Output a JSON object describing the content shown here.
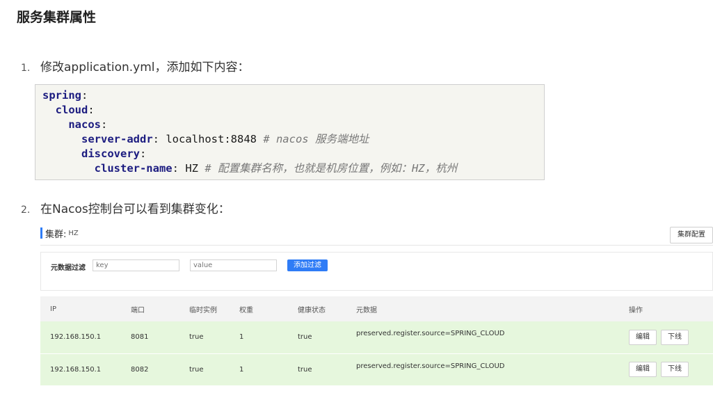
{
  "heading": "服务集群属性",
  "steps": [
    {
      "num": "1.",
      "text": "修改application.yml，添加如下内容："
    },
    {
      "num": "2.",
      "text": "在Nacos控制台可以看到集群变化："
    }
  ],
  "code": {
    "l1_key": "spring",
    "l2_key": "cloud",
    "l3_key": "nacos",
    "l4_key": "server-addr",
    "l4_val": " localhost:8848 ",
    "l4_comment": "# nacos 服务端地址",
    "l5_key": "discovery",
    "l6_key": "cluster-name",
    "l6_val": " HZ ",
    "l6_comment": "# 配置集群名称，也就是机房位置，例如：HZ，杭州"
  },
  "console": {
    "cluster_label": "集群:",
    "cluster_name": "HZ",
    "cluster_config_button": "集群配置",
    "filter_label": "元数据过滤",
    "key_placeholder": "key",
    "value_placeholder": "value",
    "add_filter_button": "添加过滤",
    "columns": [
      "IP",
      "端口",
      "临时实例",
      "权重",
      "健康状态",
      "元数据",
      "操作"
    ],
    "rows": [
      {
        "ip": "192.168.150.1",
        "port": "8081",
        "ephemeral": "true",
        "weight": "1",
        "healthy": "true",
        "metadata": "preserved.register.source=SPRING_CLOUD",
        "edit": "编辑",
        "offline": "下线"
      },
      {
        "ip": "192.168.150.1",
        "port": "8082",
        "ephemeral": "true",
        "weight": "1",
        "healthy": "true",
        "metadata": "preserved.register.source=SPRING_CLOUD",
        "edit": "编辑",
        "offline": "下线"
      }
    ],
    "accent": "#2f7cf6",
    "row_bg": "#e6f7dd"
  }
}
